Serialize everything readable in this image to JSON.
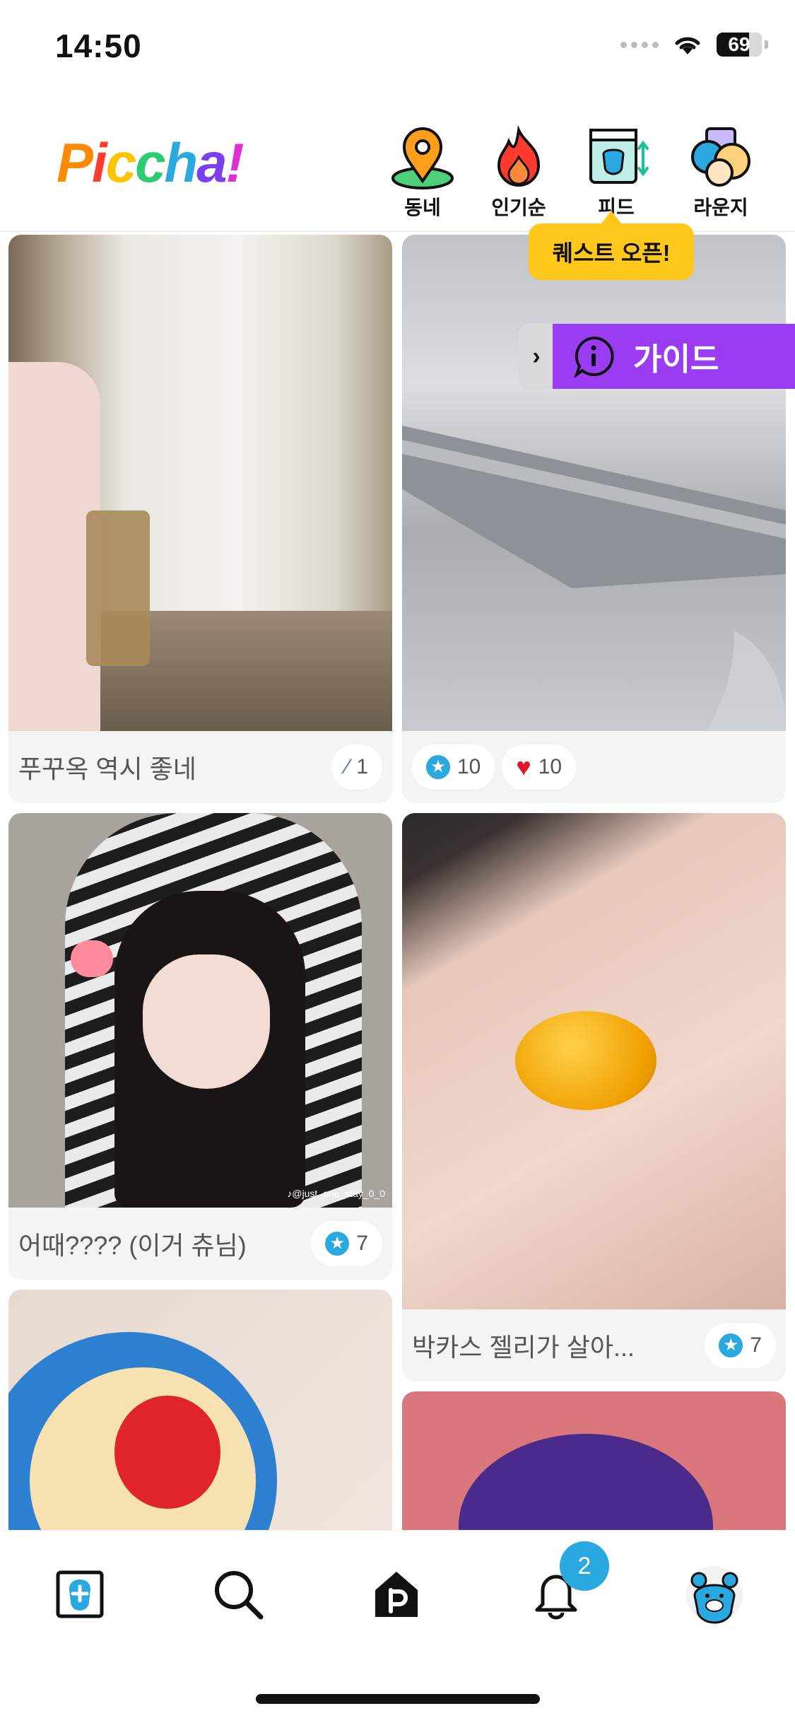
{
  "status_bar": {
    "time": "14:50",
    "battery": "69"
  },
  "header": {
    "logo": "Piccha!",
    "nav": [
      {
        "label": "동네",
        "icon": "location-pin-icon"
      },
      {
        "label": "인기순",
        "icon": "fire-icon"
      },
      {
        "label": "피드",
        "icon": "feed-icon"
      },
      {
        "label": "라운지",
        "icon": "lounge-icon"
      }
    ],
    "tooltip": "퀘스트 오픈!"
  },
  "guide": {
    "label": "가이드",
    "tab": "›"
  },
  "feed": {
    "cards": [
      {
        "caption": "푸꾸옥 역시 좋네",
        "stats": [
          {
            "icon": "slash-icon",
            "value": "1"
          }
        ]
      },
      {
        "caption": "",
        "stats": [
          {
            "icon": "star-badge-icon",
            "value": "10"
          },
          {
            "icon": "heart-icon",
            "value": "10"
          }
        ]
      },
      {
        "caption": "어때???? (이거 츄님)",
        "stats": [
          {
            "icon": "star-badge-icon",
            "value": "7"
          }
        ],
        "watermark": "♪@just_one_stay_0_0"
      },
      {
        "caption": "박카스 젤리가 살아...",
        "stats": [
          {
            "icon": "star-badge-icon",
            "value": "7"
          }
        ]
      },
      {
        "caption": "",
        "stats": []
      },
      {
        "caption": "",
        "stats": []
      }
    ]
  },
  "bottom_nav": {
    "items": [
      "add-post-icon",
      "search-icon",
      "home-icon",
      "notification-bell-icon",
      "profile-avatar-icon"
    ],
    "notification_count": "2"
  },
  "colors": {
    "accent": "#2aa8e0",
    "guide": "#9a3cf2",
    "tooltip": "#ffc81a"
  }
}
